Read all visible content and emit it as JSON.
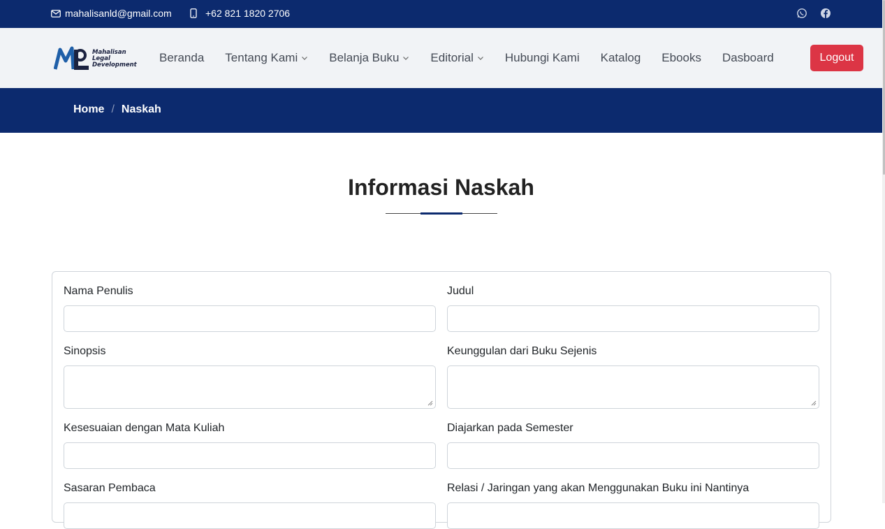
{
  "topbar": {
    "email": "mahalisanld@gmail.com",
    "phone": "+62 821 1820 2706",
    "social": [
      "whatsapp-icon",
      "facebook-icon"
    ]
  },
  "logo": {
    "line1": "Mahalisan",
    "line2": "Legal",
    "line3": "Development"
  },
  "nav": {
    "items": [
      {
        "label": "Beranda",
        "dropdown": false
      },
      {
        "label": "Tentang Kami",
        "dropdown": true
      },
      {
        "label": "Belanja Buku",
        "dropdown": true
      },
      {
        "label": "Editorial",
        "dropdown": true
      },
      {
        "label": "Hubungi Kami",
        "dropdown": false
      },
      {
        "label": "Katalog",
        "dropdown": false
      },
      {
        "label": "Ebooks",
        "dropdown": false
      },
      {
        "label": "Dasboard",
        "dropdown": false
      }
    ],
    "logout": "Logout"
  },
  "breadcrumb": {
    "home": "Home",
    "separator": "/",
    "current": "Naskah"
  },
  "section": {
    "title": "Informasi Naskah"
  },
  "form": {
    "fields": [
      {
        "label": "Nama Penulis",
        "value": "",
        "type": "input"
      },
      {
        "label": "Judul",
        "value": "",
        "type": "input"
      },
      {
        "label": "Sinopsis",
        "value": "",
        "type": "textarea"
      },
      {
        "label": "Keunggulan dari Buku Sejenis",
        "value": "",
        "type": "textarea"
      },
      {
        "label": "Kesesuaian dengan Mata Kuliah",
        "value": "",
        "type": "input"
      },
      {
        "label": "Diajarkan pada Semester",
        "value": "",
        "type": "input"
      },
      {
        "label": "Sasaran Pembaca",
        "value": "",
        "type": "input"
      },
      {
        "label": "Relasi / Jaringan yang akan Menggunakan Buku ini Nantinya",
        "value": "",
        "type": "input"
      }
    ]
  },
  "colors": {
    "brand_navy": "#0c2a6e",
    "logout_red": "#dc3545",
    "header_bg": "#f1f3f6"
  }
}
